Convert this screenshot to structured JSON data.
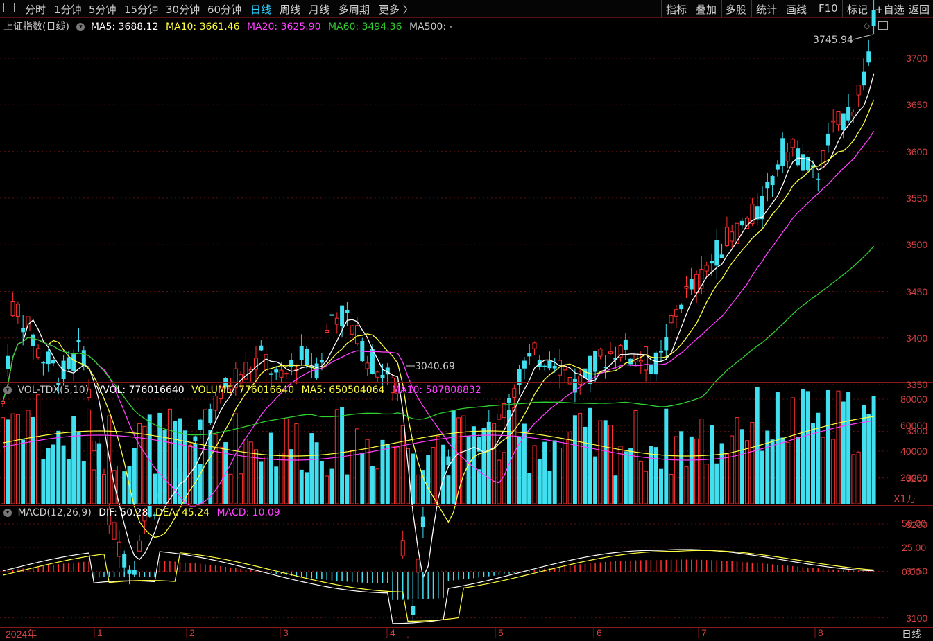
{
  "toolbar": {
    "left_icon": "panel-icon",
    "periods": [
      {
        "label": "分时"
      },
      {
        "label": "1分钟"
      },
      {
        "label": "5分钟"
      },
      {
        "label": "15分钟"
      },
      {
        "label": "30分钟"
      },
      {
        "label": "60分钟"
      },
      {
        "label": "日线",
        "active": true
      },
      {
        "label": "周线"
      },
      {
        "label": "月线"
      },
      {
        "label": "多周期"
      },
      {
        "label": "更多 〉"
      }
    ],
    "right": [
      "指标",
      "叠加",
      "多股",
      "统计",
      "画线",
      "F10",
      "标记",
      "+自选",
      "返回"
    ]
  },
  "main": {
    "title": "上证指数(日线)",
    "ma": [
      {
        "label": "MA5:",
        "value": "3688.12",
        "color": "#ffffff"
      },
      {
        "label": "MA10:",
        "value": "3661.46",
        "color": "#ffff40"
      },
      {
        "label": "MA20:",
        "value": "3625.90",
        "color": "#ff40ff"
      },
      {
        "label": "MA60:",
        "value": "3494.36",
        "color": "#30d030"
      },
      {
        "label": "MA500:",
        "value": "-",
        "color": "#c8c8c8"
      }
    ],
    "high_label": "3745.94",
    "low_label": "3040.69",
    "y_ticks": [
      "3700",
      "3650",
      "3600",
      "3550",
      "3500",
      "3450",
      "3400",
      "3350",
      "3300",
      "3250",
      "3200",
      "3150",
      "3100"
    ]
  },
  "volume": {
    "title": "VOL-TDX(5,10)",
    "items": [
      {
        "label": "VVOL:",
        "value": "776016640",
        "color": "#ffffff"
      },
      {
        "label": "VOLUME:",
        "value": "776016640",
        "color": "#ffff40"
      },
      {
        "label": "MA5:",
        "value": "650504064",
        "color": "#ffff40"
      },
      {
        "label": "MA10:",
        "value": "587808832",
        "color": "#ff40ff"
      }
    ],
    "y_ticks": [
      "80000",
      "60000",
      "40000",
      "20000"
    ],
    "unit": "X1万"
  },
  "macd": {
    "title": "MACD(12,26,9)",
    "items": [
      {
        "label": "DIF:",
        "value": "50.28",
        "color": "#ffffff"
      },
      {
        "label": "DEA:",
        "value": "45.24",
        "color": "#ffff40"
      },
      {
        "label": "MACD:",
        "value": "10.09",
        "color": "#ff40ff"
      }
    ],
    "y_ticks": [
      "50.00",
      "25.00",
      "0.00"
    ]
  },
  "x_axis": [
    "2024年",
    "1",
    "2",
    "3",
    "4",
    "5",
    "6",
    "7",
    "8"
  ],
  "corner_label": "日线",
  "colors": {
    "up": "#ff3030",
    "down": "#40e0f0",
    "grid": "#5a1010"
  }
}
